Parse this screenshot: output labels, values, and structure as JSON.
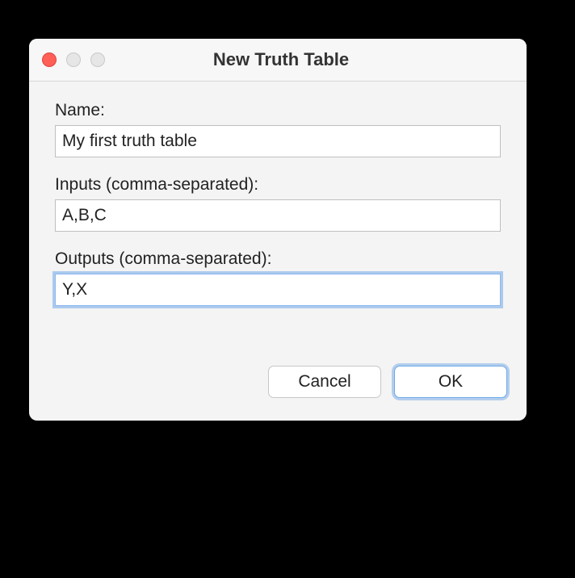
{
  "window": {
    "title": "New Truth Table"
  },
  "fields": {
    "name": {
      "label": "Name:",
      "value": "My first truth table"
    },
    "inputs": {
      "label": "Inputs (comma-separated):",
      "value": "A,B,C"
    },
    "outputs": {
      "label": "Outputs (comma-separated):",
      "value": "Y,X"
    }
  },
  "buttons": {
    "cancel": "Cancel",
    "ok": "OK"
  }
}
